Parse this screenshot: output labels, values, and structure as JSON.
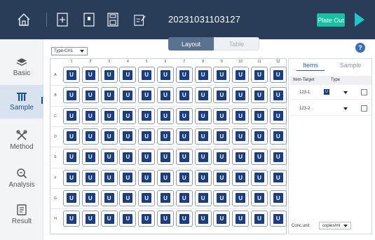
{
  "toolbar": {
    "home_icon": "home-icon",
    "icons": [
      "new-file-icon",
      "open-file-icon",
      "save-icon",
      "edit-template-icon"
    ],
    "run_id": "20231031103127",
    "plate_out_label": "Plate Out",
    "run_icon": "play-icon"
  },
  "sidebar": {
    "items": [
      {
        "label": "Basic",
        "icon": "layers-icon"
      },
      {
        "label": "Sample",
        "icon": "tubes-icon",
        "active": true
      },
      {
        "label": "Method",
        "icon": "tools-icon"
      },
      {
        "label": "Analysis",
        "icon": "magnifier-icon"
      },
      {
        "label": "Result",
        "icon": "report-icon"
      }
    ]
  },
  "content": {
    "type_select": "Type-CH1",
    "view_tabs": [
      "Layout",
      "Table"
    ],
    "active_view": "Layout",
    "help_label": "?"
  },
  "plate": {
    "columns": [
      "1",
      "2",
      "3",
      "4",
      "5",
      "6",
      "7",
      "8",
      "9",
      "10",
      "11",
      "12"
    ],
    "rows": [
      "A",
      "B",
      "C",
      "D",
      "E",
      "F",
      "G",
      "H"
    ],
    "well_label": "U"
  },
  "panel": {
    "tabs": [
      "Items",
      "Sample"
    ],
    "active_tab": "Items",
    "headers": [
      "Item-Target",
      "Type"
    ],
    "rows": [
      {
        "target": "123-1",
        "type": "U"
      },
      {
        "target": "123-2",
        "type": ""
      }
    ],
    "conc_unit_label": "Conc.unit",
    "conc_unit_value": "copies/ml"
  },
  "colors": {
    "topbar": "#2a3d58",
    "accent": "#19c1a4",
    "well_fill": "#1b3e80",
    "active_nav": "#d9e3ef"
  }
}
